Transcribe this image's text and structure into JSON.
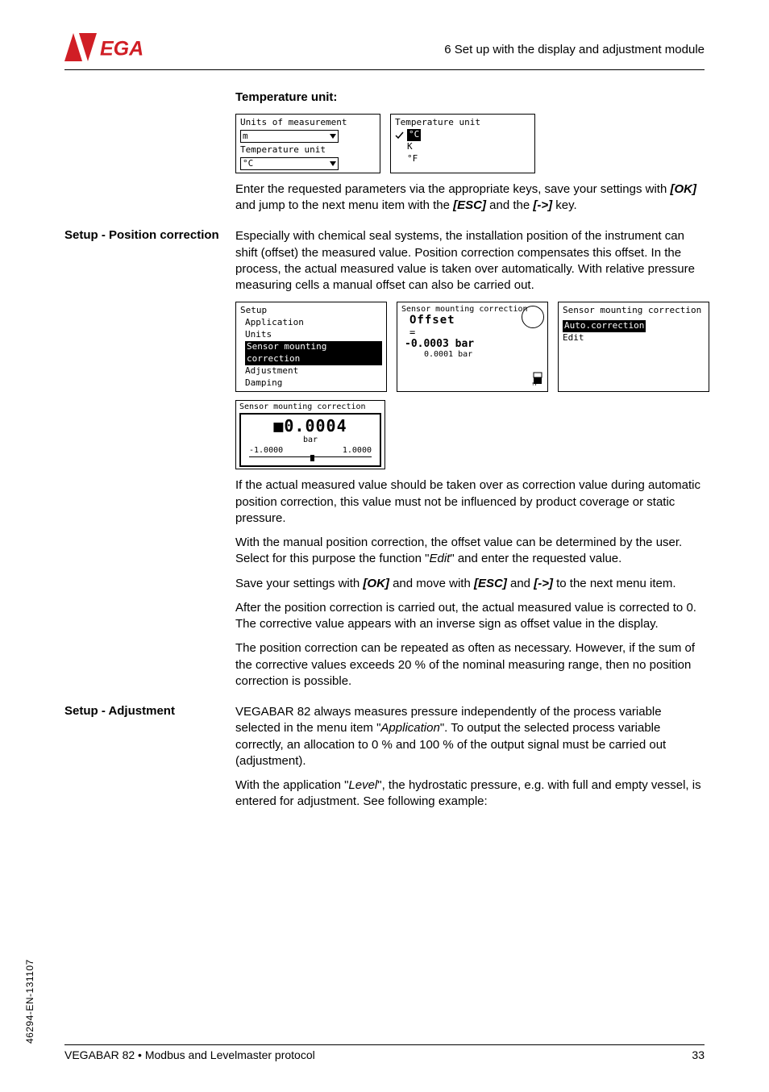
{
  "header": {
    "section": "6 Set up with the display and adjustment module"
  },
  "temp": {
    "heading": "Temperature unit:",
    "lcd1_line1": "Units of measurement",
    "lcd1_field1": "m",
    "lcd1_line2": "Temperature unit",
    "lcd1_field2": "°C",
    "lcd2_title": "Temperature unit",
    "lcd2_opt1": "°C",
    "lcd2_opt2": "K",
    "lcd2_opt3": "°F",
    "para": "Enter the requested parameters via the appropriate keys, save your settings with ",
    "ok": "[OK]",
    "para2": " and jump to the next menu item with the ",
    "esc": "[ESC]",
    "para3": " and the ",
    "arrow": "[->]",
    "para4": " key."
  },
  "position": {
    "sidebar": "Setup - Position correction",
    "p1": "Especially with chemical seal systems, the installation position of the instrument can shift (offset) the measured value. Position correction compensates this offset. In the process, the actual measured value is taken over automatically. With relative pressure measuring cells a manual offset can also be carried out.",
    "lcdA_title": "Setup",
    "lcdA_l1": "Application",
    "lcdA_l2": "Units",
    "lcdA_l3": "Sensor mounting correction",
    "lcdA_l4": "Adjustment",
    "lcdA_l5": "Damping",
    "lcdB_title": "Sensor mounting correction",
    "lcdB_big": "Offset",
    "lcdB_eq": "=",
    "lcdB_val": "-0.0003 bar",
    "lcdB_sub": "0.0001 bar",
    "lcdC_title": "Sensor mounting correction",
    "lcdC_sel": "Auto.correction",
    "lcdC_l2": "Edit",
    "lcdD_title": "Sensor mounting correction",
    "lcdD_big": "■0.0004",
    "lcdD_unit": "bar",
    "lcdD_lo": "-1.0000",
    "lcdD_hi": "1.0000",
    "p2": "If the actual measured value should be taken over as correction value during automatic position correction, this value must not be influenced by product coverage or static pressure.",
    "p3a": "With the manual position correction, the offset value can be determined by the user. Select for this purpose the function \"",
    "p3_edit": "Edit",
    "p3b": "\" and enter the requested value.",
    "p4a": "Save your settings with ",
    "p4_ok": "[OK]",
    "p4b": " and move with ",
    "p4_esc": "[ESC]",
    "p4c": " and ",
    "p4_arrow": "[->]",
    "p4d": " to the next menu item.",
    "p5": "After the position correction is carried out, the actual measured value is corrected to 0. The corrective value appears with an inverse sign as offset value in the display.",
    "p6": "The position correction can be repeated as often as necessary. However, if the sum of the corrective values exceeds 20 % of the nominal measuring range, then no position correction is possible."
  },
  "adjust": {
    "sidebar": "Setup - Adjustment",
    "p1a": "VEGABAR 82 always measures pressure independently of the process variable selected in the menu item  \"",
    "p1_app": "Application",
    "p1b": "\". To output the selected process variable correctly, an allocation to 0 % and 100 % of the output signal must be carried out (adjustment).",
    "p2a": "With the application \"",
    "p2_level": "Level",
    "p2b": "\", the hydrostatic pressure, e.g. with full and empty vessel, is entered for adjustment. See following example:"
  },
  "footer": {
    "left": "VEGABAR 82 • Modbus and Levelmaster protocol",
    "right": "33",
    "side": "46294-EN-131107"
  }
}
